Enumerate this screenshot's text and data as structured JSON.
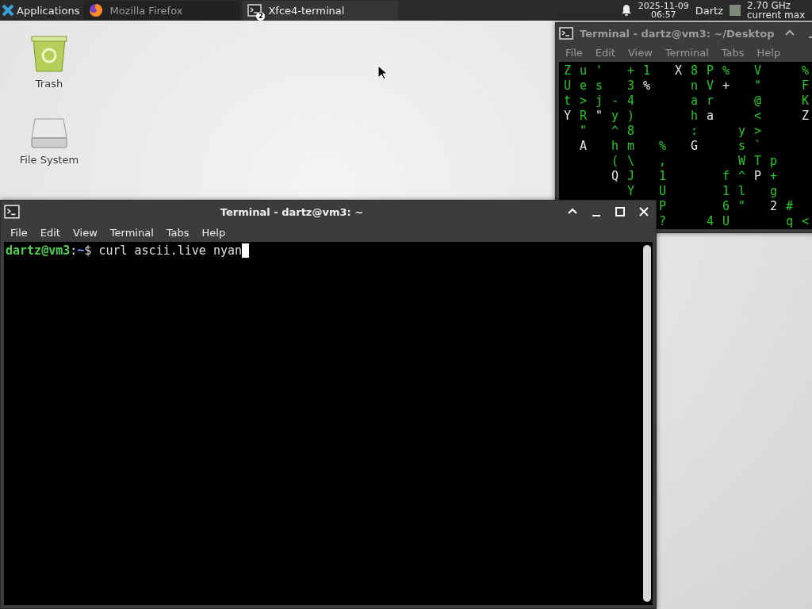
{
  "panel": {
    "menu_label": "Applications",
    "tasks": [
      {
        "label": "Mozilla Firefox",
        "kind": "browser",
        "selected": false
      },
      {
        "label": "Xfce4-terminal",
        "kind": "terminal",
        "badge": "2",
        "selected": true
      }
    ],
    "date": "2025-11-09",
    "time": "06:57",
    "user": "Dartz",
    "cpu_line_1": "2.70 GHz",
    "cpu_line_2": "current max"
  },
  "desktop_icons": [
    {
      "label": "Trash",
      "kind": "trash"
    },
    {
      "label": "File System",
      "kind": "drive"
    }
  ],
  "back_window": {
    "title": "Terminal - dartz@vm3: ~/Desktop",
    "active": false,
    "menu": [
      "File",
      "Edit",
      "View",
      "Terminal",
      "Tabs",
      "Help"
    ],
    "rows": [
      [
        {
          "t": "Z",
          "bright": false
        },
        {
          "t": "u",
          "bright": false
        },
        {
          "t": "'",
          "bright": false
        },
        null,
        {
          "t": "+",
          "bright": false
        },
        {
          "t": "1",
          "bright": false
        },
        null,
        {
          "t": "X",
          "bright": true
        },
        {
          "t": "8",
          "bright": false
        },
        {
          "t": "P",
          "bright": false
        },
        {
          "t": "%",
          "bright": false
        },
        null,
        {
          "t": "V",
          "bright": false
        },
        null,
        null,
        {
          "t": "%",
          "bright": false
        }
      ],
      [
        {
          "t": "U",
          "bright": false
        },
        {
          "t": "e",
          "bright": false
        },
        {
          "t": "s",
          "bright": false
        },
        null,
        {
          "t": "3",
          "bright": false
        },
        {
          "t": "%",
          "bright": true
        },
        null,
        null,
        {
          "t": "n",
          "bright": false
        },
        {
          "t": "V",
          "bright": false
        },
        {
          "t": "+",
          "bright": true
        },
        null,
        {
          "t": "\"",
          "bright": false
        },
        null,
        null,
        {
          "t": "F",
          "bright": false
        }
      ],
      [
        {
          "t": "t",
          "bright": false
        },
        {
          "t": ">",
          "bright": false
        },
        {
          "t": "j",
          "bright": false
        },
        {
          "t": "-",
          "bright": false
        },
        {
          "t": "4",
          "bright": false
        },
        null,
        null,
        null,
        {
          "t": "a",
          "bright": false
        },
        {
          "t": "r",
          "bright": false
        },
        null,
        null,
        {
          "t": "@",
          "bright": false
        },
        null,
        null,
        {
          "t": "K",
          "bright": false
        }
      ],
      [
        {
          "t": "Y",
          "bright": true
        },
        {
          "t": "R",
          "bright": false
        },
        {
          "t": "\"",
          "bright": true
        },
        {
          "t": "y",
          "bright": false
        },
        {
          "t": ")",
          "bright": false
        },
        null,
        null,
        null,
        {
          "t": "h",
          "bright": false
        },
        {
          "t": "a",
          "bright": true
        },
        null,
        null,
        {
          "t": "<",
          "bright": false
        },
        null,
        null,
        {
          "t": "Z",
          "bright": true
        }
      ],
      [
        null,
        {
          "t": "\"",
          "bright": false
        },
        null,
        {
          "t": "^",
          "bright": false
        },
        {
          "t": "8",
          "bright": false
        },
        null,
        null,
        null,
        {
          "t": ":",
          "bright": false
        },
        null,
        null,
        {
          "t": "y",
          "bright": false
        },
        {
          "t": ">",
          "bright": false
        },
        null,
        null,
        null
      ],
      [
        null,
        {
          "t": "A",
          "bright": true
        },
        null,
        {
          "t": "h",
          "bright": false
        },
        {
          "t": "m",
          "bright": false
        },
        null,
        {
          "t": "%",
          "bright": false
        },
        null,
        {
          "t": "G",
          "bright": true
        },
        null,
        null,
        {
          "t": "s",
          "bright": false
        },
        {
          "t": "`",
          "bright": false
        },
        null,
        null,
        null
      ],
      [
        null,
        null,
        null,
        {
          "t": "(",
          "bright": false
        },
        {
          "t": "\\",
          "bright": false
        },
        null,
        {
          "t": ",",
          "bright": false
        },
        null,
        null,
        null,
        null,
        {
          "t": "W",
          "bright": false
        },
        {
          "t": "T",
          "bright": false
        },
        {
          "t": "p",
          "bright": false
        },
        null,
        null
      ],
      [
        null,
        null,
        null,
        {
          "t": "Q",
          "bright": true
        },
        {
          "t": "J",
          "bright": false
        },
        null,
        {
          "t": "1",
          "bright": false
        },
        null,
        null,
        null,
        {
          "t": "f",
          "bright": false
        },
        {
          "t": "^",
          "bright": false
        },
        {
          "t": "P",
          "bright": true
        },
        {
          "t": "+",
          "bright": false
        },
        null,
        null
      ],
      [
        null,
        null,
        null,
        null,
        {
          "t": "Y",
          "bright": false
        },
        null,
        {
          "t": "U",
          "bright": false
        },
        null,
        null,
        null,
        {
          "t": "1",
          "bright": false
        },
        {
          "t": "l",
          "bright": false
        },
        null,
        {
          "t": "g",
          "bright": false
        },
        null,
        null
      ],
      [
        null,
        null,
        null,
        null,
        null,
        null,
        {
          "t": "P",
          "bright": false
        },
        null,
        null,
        null,
        {
          "t": "6",
          "bright": false
        },
        {
          "t": "\"",
          "bright": false
        },
        null,
        {
          "t": "2",
          "bright": true
        },
        {
          "t": "#",
          "bright": false
        },
        null
      ],
      [
        null,
        null,
        null,
        null,
        null,
        null,
        {
          "t": "?",
          "bright": false
        },
        null,
        null,
        {
          "t": "4",
          "bright": false
        },
        {
          "t": "U",
          "bright": false
        },
        null,
        null,
        null,
        {
          "t": "q",
          "bright": false
        },
        {
          "t": "<",
          "bright": false
        }
      ]
    ]
  },
  "front_window": {
    "title": "Terminal - dartz@vm3: ~",
    "active": true,
    "menu": [
      "File",
      "Edit",
      "View",
      "Terminal",
      "Tabs",
      "Help"
    ],
    "prompt_user": "dartz@vm3",
    "prompt_sep": ":",
    "prompt_path": "~",
    "prompt_sign": "$",
    "command": "curl ascii.live nyan"
  }
}
